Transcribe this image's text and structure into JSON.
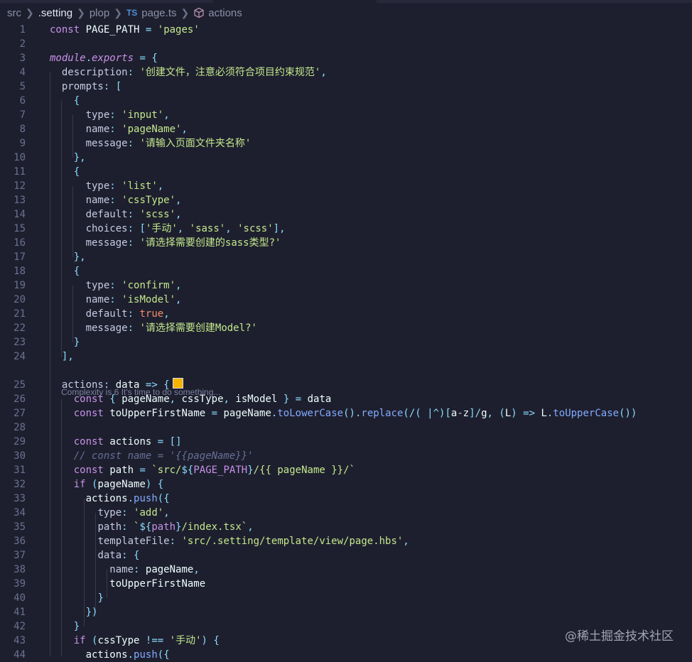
{
  "breadcrumb": {
    "items": [
      "src",
      ".setting",
      "plop",
      "page.ts",
      "actions"
    ],
    "ts_badge": "TS"
  },
  "code_lens": "Complexity is 6 It's time to do something...",
  "watermark": "@稀土掘金技术社区",
  "colors": {
    "background": "#1e1f2e",
    "keyword": "#c792ea",
    "string": "#c3e88d",
    "punctuation": "#89ddff",
    "function": "#82aaff",
    "comment": "#676e95",
    "swatch": "#f5b400"
  },
  "lines": [
    {
      "n": "1",
      "t": "const PAGE_PATH = 'pages'"
    },
    {
      "n": "2",
      "t": ""
    },
    {
      "n": "3",
      "t": "module.exports = {"
    },
    {
      "n": "4",
      "t": "  description: '创建文件，注意必须符合项目约束规范',"
    },
    {
      "n": "5",
      "t": "  prompts: ["
    },
    {
      "n": "6",
      "t": "    {"
    },
    {
      "n": "7",
      "t": "      type: 'input',"
    },
    {
      "n": "8",
      "t": "      name: 'pageName',"
    },
    {
      "n": "9",
      "t": "      message: '请输入页面文件夹名称'"
    },
    {
      "n": "10",
      "t": "    },"
    },
    {
      "n": "11",
      "t": "    {"
    },
    {
      "n": "12",
      "t": "      type: 'list',"
    },
    {
      "n": "13",
      "t": "      name: 'cssType',"
    },
    {
      "n": "14",
      "t": "      default: 'scss',"
    },
    {
      "n": "15",
      "t": "      choices: ['手动', 'sass', 'scss'],"
    },
    {
      "n": "16",
      "t": "      message: '请选择需要创建的sass类型?'"
    },
    {
      "n": "17",
      "t": "    },"
    },
    {
      "n": "18",
      "t": "    {"
    },
    {
      "n": "19",
      "t": "      type: 'confirm',"
    },
    {
      "n": "20",
      "t": "      name: 'isModel',"
    },
    {
      "n": "21",
      "t": "      default: true,"
    },
    {
      "n": "22",
      "t": "      message: '请选择需要创建Model?'"
    },
    {
      "n": "23",
      "t": "    }"
    },
    {
      "n": "24",
      "t": "  ],"
    },
    {
      "n": "25",
      "t": "  actions: data => {"
    },
    {
      "n": "26",
      "t": "    const { pageName, cssType, isModel } = data"
    },
    {
      "n": "27",
      "t": "    const toUpperFirstName = pageName.toLowerCase().replace(/( |^)[a-z]/g, (L) => L.toUpperCase())"
    },
    {
      "n": "28",
      "t": ""
    },
    {
      "n": "29",
      "t": "    const actions = []"
    },
    {
      "n": "30",
      "t": "    // const name = '{{pageName}}'"
    },
    {
      "n": "31",
      "t": "    const path = `src/${PAGE_PATH}/{{ pageName }}/`"
    },
    {
      "n": "32",
      "t": "    if (pageName) {"
    },
    {
      "n": "33",
      "t": "      actions.push({"
    },
    {
      "n": "34",
      "t": "        type: 'add',"
    },
    {
      "n": "35",
      "t": "        path: `${path}/index.tsx`,"
    },
    {
      "n": "36",
      "t": "        templateFile: 'src/.setting/template/view/page.hbs',"
    },
    {
      "n": "37",
      "t": "        data: {"
    },
    {
      "n": "38",
      "t": "          name: pageName,"
    },
    {
      "n": "39",
      "t": "          toUpperFirstName"
    },
    {
      "n": "40",
      "t": "        }"
    },
    {
      "n": "41",
      "t": "      })"
    },
    {
      "n": "42",
      "t": "    }"
    },
    {
      "n": "43",
      "t": "    if (cssType !== '手动') {"
    },
    {
      "n": "44",
      "t": "      actions.push({"
    }
  ]
}
